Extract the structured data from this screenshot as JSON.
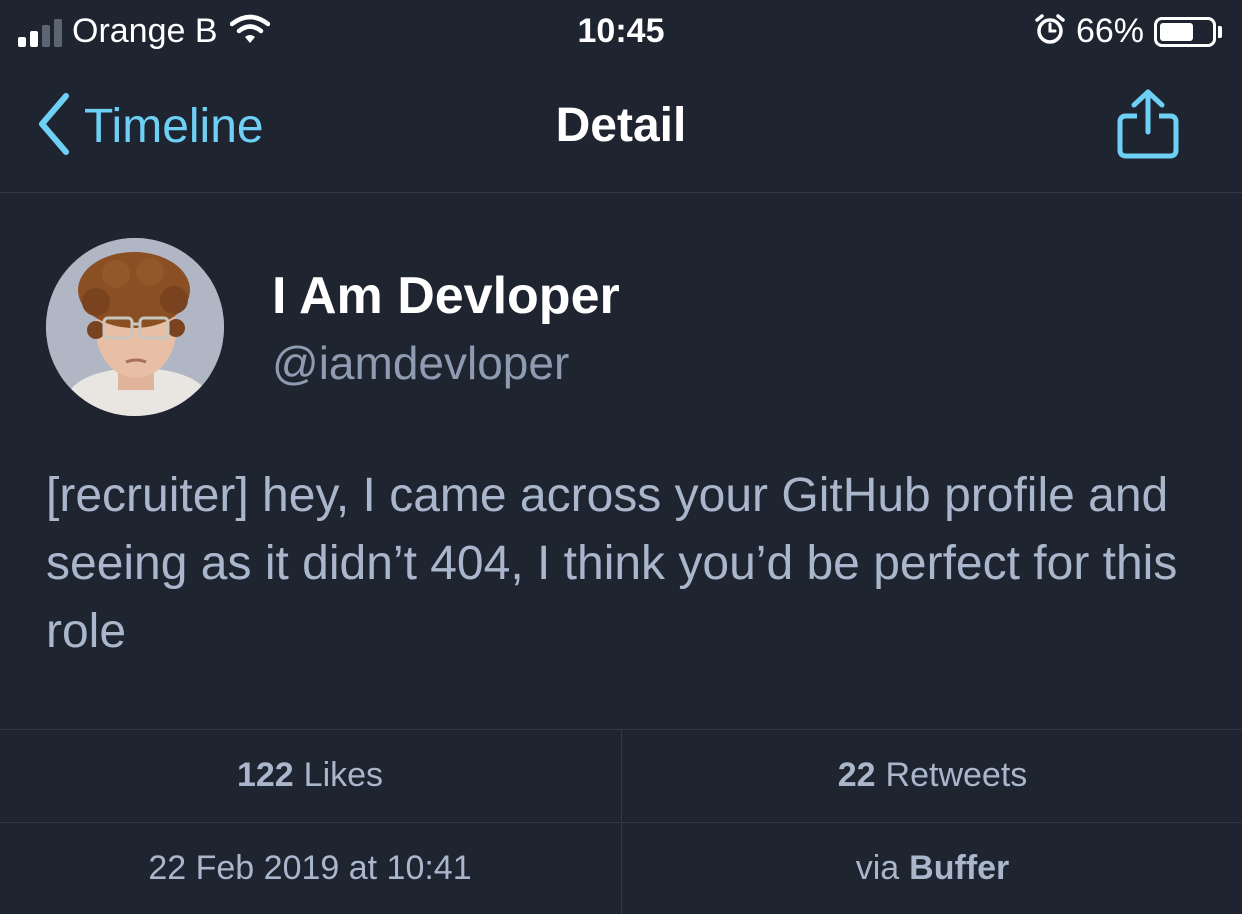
{
  "status_bar": {
    "carrier": "Orange B",
    "time": "10:45",
    "battery_percent": "66%",
    "battery_level": 0.66,
    "signal_bars": 2,
    "icons": [
      "signal-icon",
      "wifi-icon",
      "alarm-icon",
      "battery-icon"
    ]
  },
  "nav": {
    "back_label": "Timeline",
    "title": "Detail",
    "icons": [
      "chevron-left-icon",
      "share-icon"
    ]
  },
  "tweet": {
    "display_name": "I Am Devloper",
    "handle": "@iamdevloper",
    "text": "[recruiter] hey, I came across your GitHub profile and seeing as it didn’t 404, I think you’d be perfect for this role",
    "likes_count": "122",
    "likes_label": "Likes",
    "retweets_count": "22",
    "retweets_label": "Retweets",
    "timestamp": "22 Feb 2019 at 10:41",
    "via_label": "via",
    "via_app": "Buffer"
  },
  "colors": {
    "background": "#1e2430",
    "accent": "#6fd0f5",
    "body_text": "#a9b6cb",
    "secondary_text": "#8f9bb0",
    "divider": "#323a48"
  }
}
